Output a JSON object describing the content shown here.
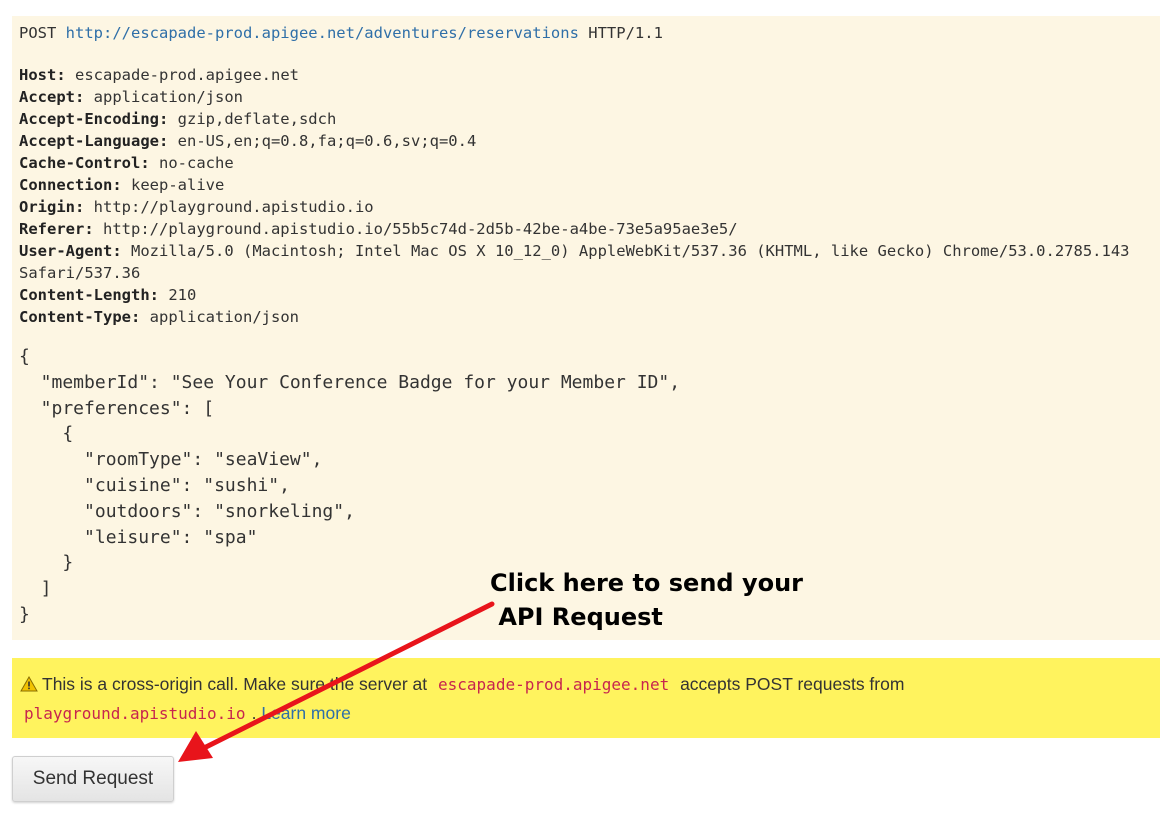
{
  "request": {
    "method": "POST",
    "url": "http://escapade-prod.apigee.net/adventures/reservations",
    "protocol": "HTTP/1.1",
    "headers": [
      {
        "name": "Host:",
        "value": "escapade-prod.apigee.net"
      },
      {
        "name": "Accept:",
        "value": "application/json"
      },
      {
        "name": "Accept-Encoding:",
        "value": "gzip,deflate,sdch"
      },
      {
        "name": "Accept-Language:",
        "value": "en-US,en;q=0.8,fa;q=0.6,sv;q=0.4"
      },
      {
        "name": "Cache-Control:",
        "value": "no-cache"
      },
      {
        "name": "Connection:",
        "value": "keep-alive"
      },
      {
        "name": "Origin:",
        "value": "http://playground.apistudio.io"
      },
      {
        "name": "Referer:",
        "value": "http://playground.apistudio.io/55b5c74d-2d5b-42be-a4be-73e5a95ae3e5/"
      },
      {
        "name": "User-Agent:",
        "value": "Mozilla/5.0 (Macintosh; Intel Mac OS X 10_12_0) AppleWebKit/537.36 (KHTML, like Gecko) Chrome/53.0.2785.143 Safari/537.36"
      },
      {
        "name": "Content-Length:",
        "value": "210"
      },
      {
        "name": "Content-Type:",
        "value": "application/json"
      }
    ],
    "body": "{\n  \"memberId\": \"See Your Conference Badge for your Member ID\",\n  \"preferences\": [\n    {\n      \"roomType\": \"seaView\",\n      \"cuisine\": \"sushi\",\n      \"outdoors\": \"snorkeling\",\n      \"leisure\": \"spa\"\n    }\n  ]\n}"
  },
  "warning": {
    "icon": "warning-triangle-icon",
    "text_before": "This is a cross-origin call. Make sure the server at",
    "server": "escapade-prod.apigee.net",
    "text_middle": "accepts POST requests from",
    "origin": "playground.apistudio.io",
    "text_after": ".",
    "learn_more": "Learn more"
  },
  "send_button": {
    "label": "Send Request"
  },
  "annotation": {
    "text": "Click here to send your\n API Request",
    "arrow_color": "#e8141b"
  },
  "colors": {
    "panel_bg": "#fdf6e3",
    "warning_bg": "#fff35e",
    "link": "#2f6fa8",
    "code": "#c7254e"
  }
}
